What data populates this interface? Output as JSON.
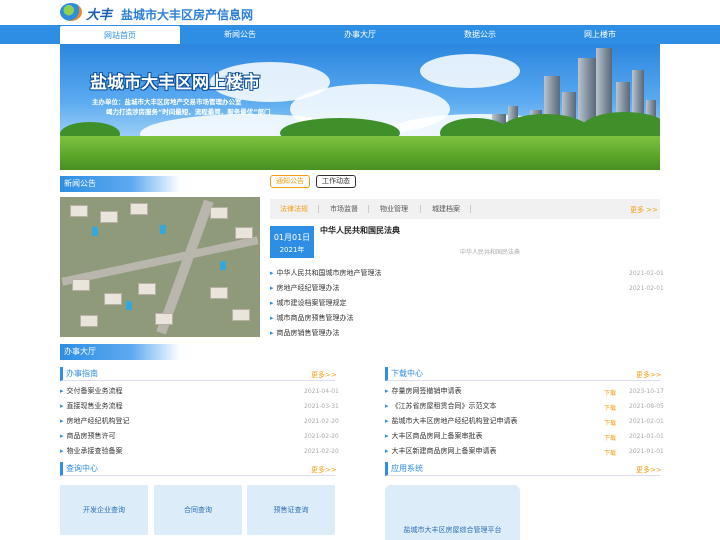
{
  "header": {
    "logo_text": "大丰",
    "site_title": "盐城市大丰区房产信息网"
  },
  "nav": {
    "items": [
      {
        "label": "网站首页",
        "active": true
      },
      {
        "label": "新闻公告"
      },
      {
        "label": "办事大厅"
      },
      {
        "label": "数据公示"
      },
      {
        "label": "网上楼市"
      }
    ]
  },
  "banner": {
    "title": "盐城市大丰区网上楼市",
    "sponsor": "主办单位：盐城市大丰区房地产交易市场管理办公室",
    "slogan": "竭力打造涉房服务“时间最短，流程最简，服务最优”部门"
  },
  "news": {
    "section_title": "新闻公告",
    "tabs": [
      "通知公告",
      "工作动态"
    ],
    "subtabs": [
      "法律法规",
      "市场监督",
      "物业管理",
      "城建档案"
    ],
    "more": "更多 >>",
    "featured": {
      "date": "01月01日",
      "year": "2021年",
      "title": "中华人民共和国民法典",
      "summary": "中华人民共和国民法典"
    },
    "items": [
      {
        "title": "中华人民共和国城市房地产管理法",
        "date": "2021-02-01"
      },
      {
        "title": "房地产经纪管理办法",
        "date": "2021-02-01"
      },
      {
        "title": "城市建设档案管理规定",
        "date": ""
      },
      {
        "title": "城市商品房预售管理办法",
        "date": ""
      },
      {
        "title": "商品房销售管理办法",
        "date": ""
      }
    ]
  },
  "hall": {
    "section_title": "办事大厅",
    "guide": {
      "title": "办事指南",
      "more": "更多>>",
      "items": [
        {
          "title": "交付备案业务流程",
          "date": "2021-04-01"
        },
        {
          "title": "直接现售业务流程",
          "date": "2021-03-31"
        },
        {
          "title": "房地产经纪机构登记",
          "date": "2021-02-20"
        },
        {
          "title": "商品房预售许可",
          "date": "2021-02-20"
        },
        {
          "title": "物业承接查验备案",
          "date": "2021-02-20"
        }
      ]
    },
    "download": {
      "title": "下载中心",
      "more": "更多>>",
      "dl_label": "下载",
      "items": [
        {
          "title": "存量房网签撤销申请表",
          "date": "2023-10-17"
        },
        {
          "title": "《江苏省房屋租赁合同》示范文本",
          "date": "2021-08-05"
        },
        {
          "title": "盐城市大丰区房地产经纪机构登记申请表",
          "date": "2021-02-01"
        },
        {
          "title": "大丰区商品房网上备案审批表",
          "date": "2021-01-01"
        },
        {
          "title": "大丰区新建商品房网上备案申请表",
          "date": "2021-01-01"
        }
      ]
    },
    "query": {
      "title": "查询中心",
      "more": "更多>>",
      "items": [
        "开发企业查询",
        "合同查询",
        "预售证查询"
      ]
    },
    "apps": {
      "title": "应用系统",
      "more": "更多>>",
      "items": [
        "盐城市大丰区房屋综合管理平台"
      ]
    }
  },
  "colors": {
    "primary": "#2d8ee3",
    "accent": "#f39c12"
  }
}
